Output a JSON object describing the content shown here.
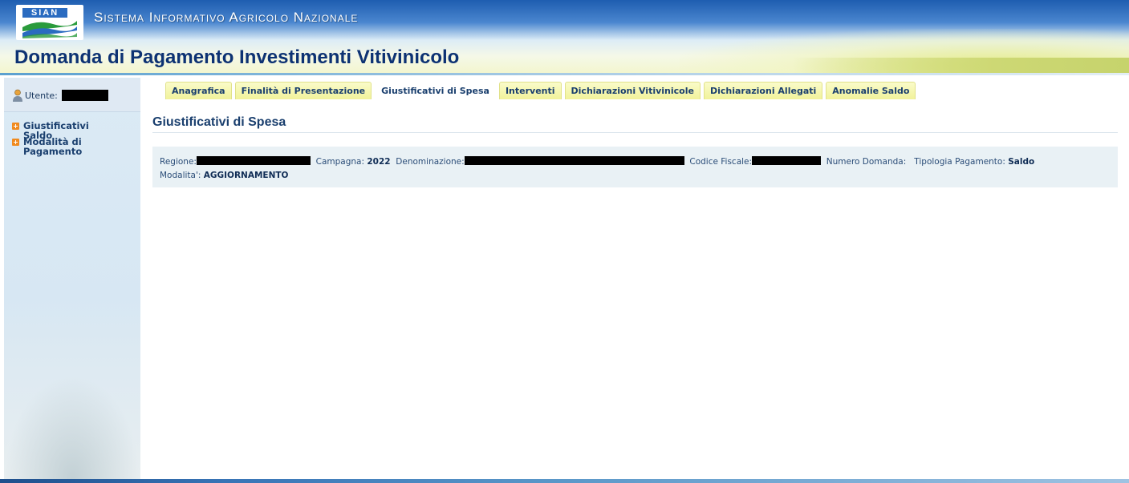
{
  "header": {
    "logo_text": "SIAN",
    "system_title": "Sistema Informativo Agricolo Nazionale",
    "app_title": "Domanda di Pagamento Investimenti Vitivinicolo"
  },
  "sidebar": {
    "user_label": "Utente:",
    "items": [
      {
        "label": "Giustificativi Saldo"
      },
      {
        "label": "Modalità di Pagamento"
      }
    ]
  },
  "tabs": [
    {
      "label": "Anagrafica",
      "active": false
    },
    {
      "label": "Finalità di Presentazione",
      "active": false
    },
    {
      "label": "Giustificativi di Spesa",
      "active": true
    },
    {
      "label": "Interventi",
      "active": false
    },
    {
      "label": "Dichiarazioni Vitivinicole",
      "active": false
    },
    {
      "label": "Dichiarazioni Allegati",
      "active": false
    },
    {
      "label": "Anomalie Saldo",
      "active": false
    }
  ],
  "page": {
    "title": "Giustificativi di Spesa"
  },
  "info": {
    "regione_label": "Regione:",
    "campagna_label": "Campagna:",
    "campagna_value": "2022",
    "denominazione_label": "Denominazione:",
    "codice_fiscale_label": "Codice Fiscale:",
    "numero_domanda_label": "Numero Domanda:",
    "tipologia_label": "Tipologia Pagamento:",
    "tipologia_value": "Saldo",
    "modalita_label": "Modalita':",
    "modalita_value": "AGGIORNAMENTO"
  }
}
